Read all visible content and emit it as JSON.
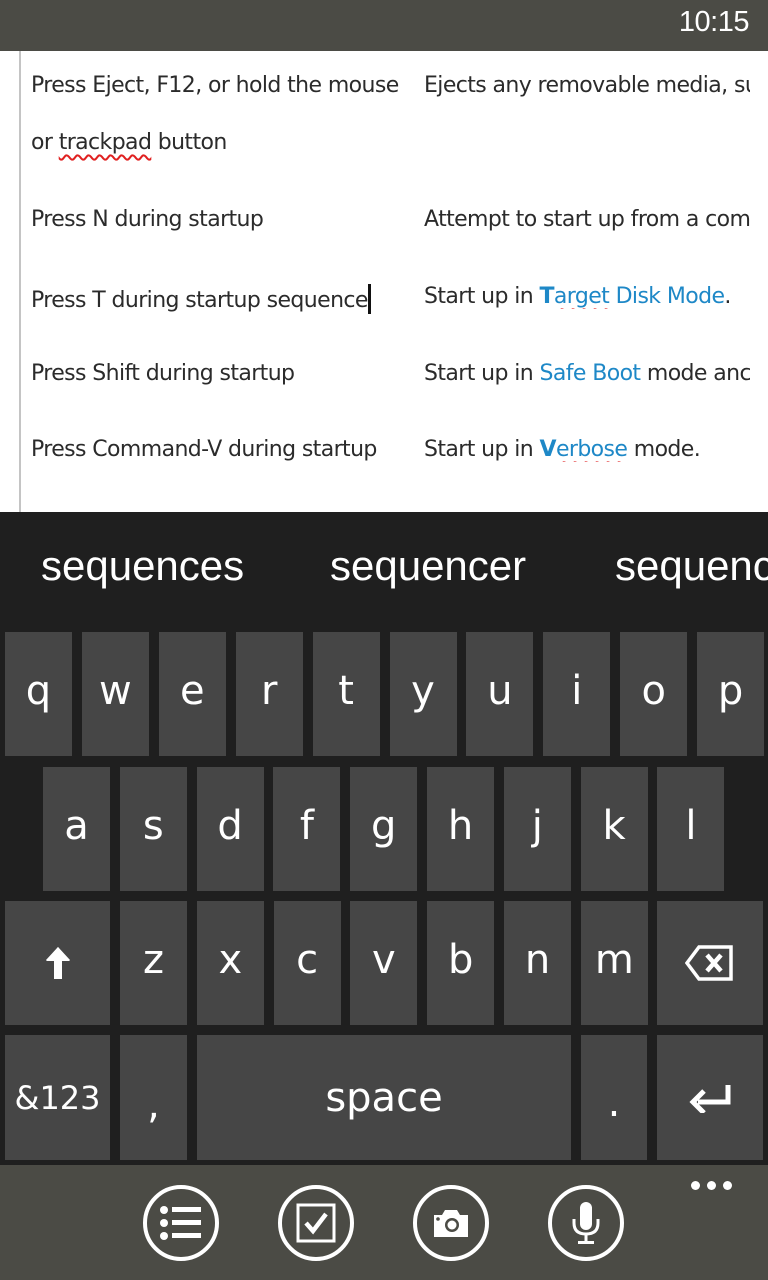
{
  "status_bar": {
    "time": "10:15"
  },
  "document": {
    "rows": [
      {
        "left": "Press Eject, F12, or hold the mouse",
        "right_parts": [
          "Ejects any removable media, su"
        ]
      },
      {
        "left_prefix": "or ",
        "left_misspelled": "trackpad",
        "left_suffix": " button"
      },
      {
        "left": "Press N during startup",
        "right_parts": [
          "Attempt to start up from a com"
        ]
      },
      {
        "left": "Press T during startup sequence",
        "right_prefix": "Start up in ",
        "right_link_bold": "T",
        "right_link_misspelled": "arget",
        "right_link_rest": " Disk Mode",
        "right_suffix": "."
      },
      {
        "left": "Press Shift during startup",
        "right_prefix": "Start up in ",
        "right_link": "Safe Boot",
        "right_suffix": " mode anc"
      },
      {
        "left": "Press Command-V during startup",
        "right_prefix": "Start up in ",
        "right_link_bold": "V",
        "right_link_misspelled": "erbose",
        "right_suffix": " mode."
      }
    ],
    "link_color": "#1e88c7"
  },
  "keyboard": {
    "suggestions": [
      "sequences",
      "sequencer",
      "sequenc"
    ],
    "row1": [
      "q",
      "w",
      "e",
      "r",
      "t",
      "y",
      "u",
      "i",
      "o",
      "p"
    ],
    "row2": [
      "a",
      "s",
      "d",
      "f",
      "g",
      "h",
      "j",
      "k",
      "l"
    ],
    "row3": [
      "z",
      "x",
      "c",
      "v",
      "b",
      "n",
      "m"
    ],
    "shift_icon": "shift-up-arrow-icon",
    "backspace_icon": "backspace-icon",
    "symbols_label": "&123",
    "comma_label": ",",
    "space_label": "space",
    "period_label": ".",
    "enter_icon": "enter-icon"
  },
  "app_bar": {
    "buttons": [
      "bulleted-list-icon",
      "checkbox-icon",
      "camera-icon",
      "microphone-icon"
    ],
    "more_icon": "more-dots-icon"
  }
}
